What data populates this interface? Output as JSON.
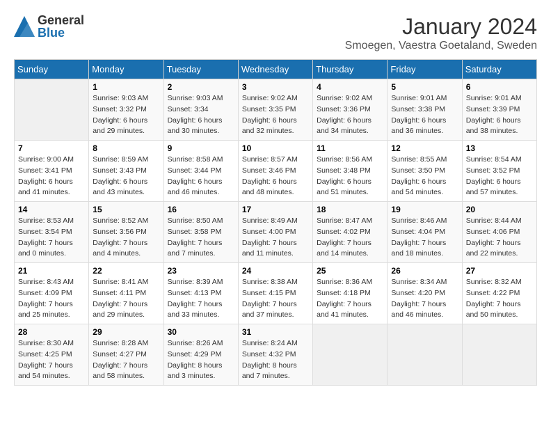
{
  "logo": {
    "general": "General",
    "blue": "Blue"
  },
  "title": "January 2024",
  "location": "Smoegen, Vaestra Goetaland, Sweden",
  "days_of_week": [
    "Sunday",
    "Monday",
    "Tuesday",
    "Wednesday",
    "Thursday",
    "Friday",
    "Saturday"
  ],
  "weeks": [
    [
      {
        "day": "",
        "sunrise": "",
        "sunset": "",
        "daylight": ""
      },
      {
        "day": "1",
        "sunrise": "Sunrise: 9:03 AM",
        "sunset": "Sunset: 3:32 PM",
        "daylight": "Daylight: 6 hours and 29 minutes."
      },
      {
        "day": "2",
        "sunrise": "Sunrise: 9:03 AM",
        "sunset": "Sunset: 3:34",
        "daylight": "Daylight: 6 hours and 30 minutes."
      },
      {
        "day": "3",
        "sunrise": "Sunrise: 9:02 AM",
        "sunset": "Sunset: 3:35 PM",
        "daylight": "Daylight: 6 hours and 32 minutes."
      },
      {
        "day": "4",
        "sunrise": "Sunrise: 9:02 AM",
        "sunset": "Sunset: 3:36 PM",
        "daylight": "Daylight: 6 hours and 34 minutes."
      },
      {
        "day": "5",
        "sunrise": "Sunrise: 9:01 AM",
        "sunset": "Sunset: 3:38 PM",
        "daylight": "Daylight: 6 hours and 36 minutes."
      },
      {
        "day": "6",
        "sunrise": "Sunrise: 9:01 AM",
        "sunset": "Sunset: 3:39 PM",
        "daylight": "Daylight: 6 hours and 38 minutes."
      }
    ],
    [
      {
        "day": "7",
        "sunrise": "Sunrise: 9:00 AM",
        "sunset": "Sunset: 3:41 PM",
        "daylight": "Daylight: 6 hours and 41 minutes."
      },
      {
        "day": "8",
        "sunrise": "Sunrise: 8:59 AM",
        "sunset": "Sunset: 3:43 PM",
        "daylight": "Daylight: 6 hours and 43 minutes."
      },
      {
        "day": "9",
        "sunrise": "Sunrise: 8:58 AM",
        "sunset": "Sunset: 3:44 PM",
        "daylight": "Daylight: 6 hours and 46 minutes."
      },
      {
        "day": "10",
        "sunrise": "Sunrise: 8:57 AM",
        "sunset": "Sunset: 3:46 PM",
        "daylight": "Daylight: 6 hours and 48 minutes."
      },
      {
        "day": "11",
        "sunrise": "Sunrise: 8:56 AM",
        "sunset": "Sunset: 3:48 PM",
        "daylight": "Daylight: 6 hours and 51 minutes."
      },
      {
        "day": "12",
        "sunrise": "Sunrise: 8:55 AM",
        "sunset": "Sunset: 3:50 PM",
        "daylight": "Daylight: 6 hours and 54 minutes."
      },
      {
        "day": "13",
        "sunrise": "Sunrise: 8:54 AM",
        "sunset": "Sunset: 3:52 PM",
        "daylight": "Daylight: 6 hours and 57 minutes."
      }
    ],
    [
      {
        "day": "14",
        "sunrise": "Sunrise: 8:53 AM",
        "sunset": "Sunset: 3:54 PM",
        "daylight": "Daylight: 7 hours and 0 minutes."
      },
      {
        "day": "15",
        "sunrise": "Sunrise: 8:52 AM",
        "sunset": "Sunset: 3:56 PM",
        "daylight": "Daylight: 7 hours and 4 minutes."
      },
      {
        "day": "16",
        "sunrise": "Sunrise: 8:50 AM",
        "sunset": "Sunset: 3:58 PM",
        "daylight": "Daylight: 7 hours and 7 minutes."
      },
      {
        "day": "17",
        "sunrise": "Sunrise: 8:49 AM",
        "sunset": "Sunset: 4:00 PM",
        "daylight": "Daylight: 7 hours and 11 minutes."
      },
      {
        "day": "18",
        "sunrise": "Sunrise: 8:47 AM",
        "sunset": "Sunset: 4:02 PM",
        "daylight": "Daylight: 7 hours and 14 minutes."
      },
      {
        "day": "19",
        "sunrise": "Sunrise: 8:46 AM",
        "sunset": "Sunset: 4:04 PM",
        "daylight": "Daylight: 7 hours and 18 minutes."
      },
      {
        "day": "20",
        "sunrise": "Sunrise: 8:44 AM",
        "sunset": "Sunset: 4:06 PM",
        "daylight": "Daylight: 7 hours and 22 minutes."
      }
    ],
    [
      {
        "day": "21",
        "sunrise": "Sunrise: 8:43 AM",
        "sunset": "Sunset: 4:09 PM",
        "daylight": "Daylight: 7 hours and 25 minutes."
      },
      {
        "day": "22",
        "sunrise": "Sunrise: 8:41 AM",
        "sunset": "Sunset: 4:11 PM",
        "daylight": "Daylight: 7 hours and 29 minutes."
      },
      {
        "day": "23",
        "sunrise": "Sunrise: 8:39 AM",
        "sunset": "Sunset: 4:13 PM",
        "daylight": "Daylight: 7 hours and 33 minutes."
      },
      {
        "day": "24",
        "sunrise": "Sunrise: 8:38 AM",
        "sunset": "Sunset: 4:15 PM",
        "daylight": "Daylight: 7 hours and 37 minutes."
      },
      {
        "day": "25",
        "sunrise": "Sunrise: 8:36 AM",
        "sunset": "Sunset: 4:18 PM",
        "daylight": "Daylight: 7 hours and 41 minutes."
      },
      {
        "day": "26",
        "sunrise": "Sunrise: 8:34 AM",
        "sunset": "Sunset: 4:20 PM",
        "daylight": "Daylight: 7 hours and 46 minutes."
      },
      {
        "day": "27",
        "sunrise": "Sunrise: 8:32 AM",
        "sunset": "Sunset: 4:22 PM",
        "daylight": "Daylight: 7 hours and 50 minutes."
      }
    ],
    [
      {
        "day": "28",
        "sunrise": "Sunrise: 8:30 AM",
        "sunset": "Sunset: 4:25 PM",
        "daylight": "Daylight: 7 hours and 54 minutes."
      },
      {
        "day": "29",
        "sunrise": "Sunrise: 8:28 AM",
        "sunset": "Sunset: 4:27 PM",
        "daylight": "Daylight: 7 hours and 58 minutes."
      },
      {
        "day": "30",
        "sunrise": "Sunrise: 8:26 AM",
        "sunset": "Sunset: 4:29 PM",
        "daylight": "Daylight: 8 hours and 3 minutes."
      },
      {
        "day": "31",
        "sunrise": "Sunrise: 8:24 AM",
        "sunset": "Sunset: 4:32 PM",
        "daylight": "Daylight: 8 hours and 7 minutes."
      },
      {
        "day": "",
        "sunrise": "",
        "sunset": "",
        "daylight": ""
      },
      {
        "day": "",
        "sunrise": "",
        "sunset": "",
        "daylight": ""
      },
      {
        "day": "",
        "sunrise": "",
        "sunset": "",
        "daylight": ""
      }
    ]
  ]
}
